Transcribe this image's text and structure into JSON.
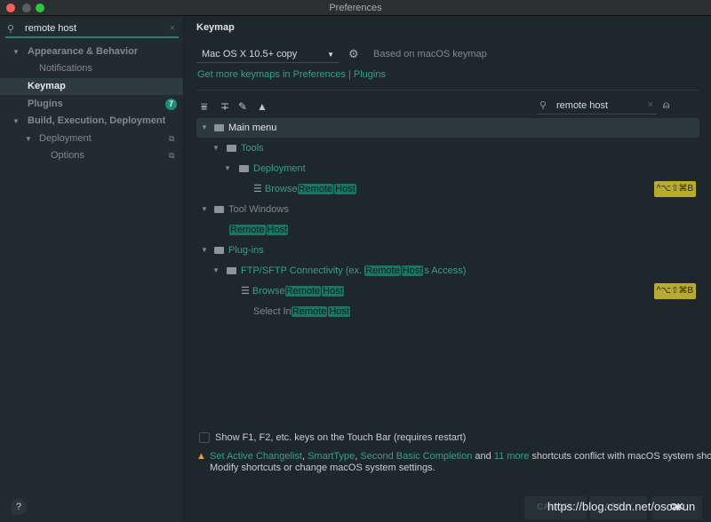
{
  "window": {
    "title": "Preferences"
  },
  "sidebar": {
    "search_value": "remote host",
    "items": [
      {
        "label": "Appearance & Behavior",
        "expanded": true
      },
      {
        "label": "Notifications"
      },
      {
        "label": "Keymap",
        "selected": true
      },
      {
        "label": "Plugins",
        "badge": "7"
      },
      {
        "label": "Build, Execution, Deployment",
        "expanded": true
      },
      {
        "label": "Deployment",
        "expanded": true
      },
      {
        "label": "Options"
      }
    ]
  },
  "main": {
    "title": "Keymap",
    "keymap_select": "Mac OS X 10.5+ copy",
    "based_on": "Based on macOS keymap",
    "get_more_link": "Get more keymaps in Preferences | Plugins",
    "search_value": "remote host",
    "tree": {
      "main_menu": "Main menu",
      "tools": "Tools",
      "deployment": "Deployment",
      "browse": "Browse",
      "remote": "Remote",
      "host": "Host",
      "shortcut": "^⌥⇧⌘B",
      "tool_windows": "Tool Windows",
      "plugins": "Plug-ins",
      "ftp_prefix": "FTP/SFTP Connectivity (ex. ",
      "hosts_suffix": "s Access)",
      "select_in": "Select In"
    },
    "touchbar_label": "Show F1, F2, etc. keys on the Touch Bar (requires restart)",
    "touchbar_checked": false,
    "warning": {
      "link1": "Set Active Changelist",
      "sep1": ", ",
      "link2": "SmartType",
      "sep2": ", ",
      "link3": "Second Basic Completion",
      "and": " and ",
      "link4": "11 more",
      "rest": " shortcuts conflict with macOS system short",
      "line2": "Modify shortcuts or change macOS system settings."
    }
  },
  "footer": {
    "help": "?",
    "cancel": "CANCEL",
    "apply": "APPLY",
    "ok": "OK",
    "watermark": "https://blog.csdn.net/oscarun"
  },
  "colors": {
    "accent": "#3a9e8b",
    "highlight": "#1b7564",
    "shortcut": "#b7aa32"
  }
}
